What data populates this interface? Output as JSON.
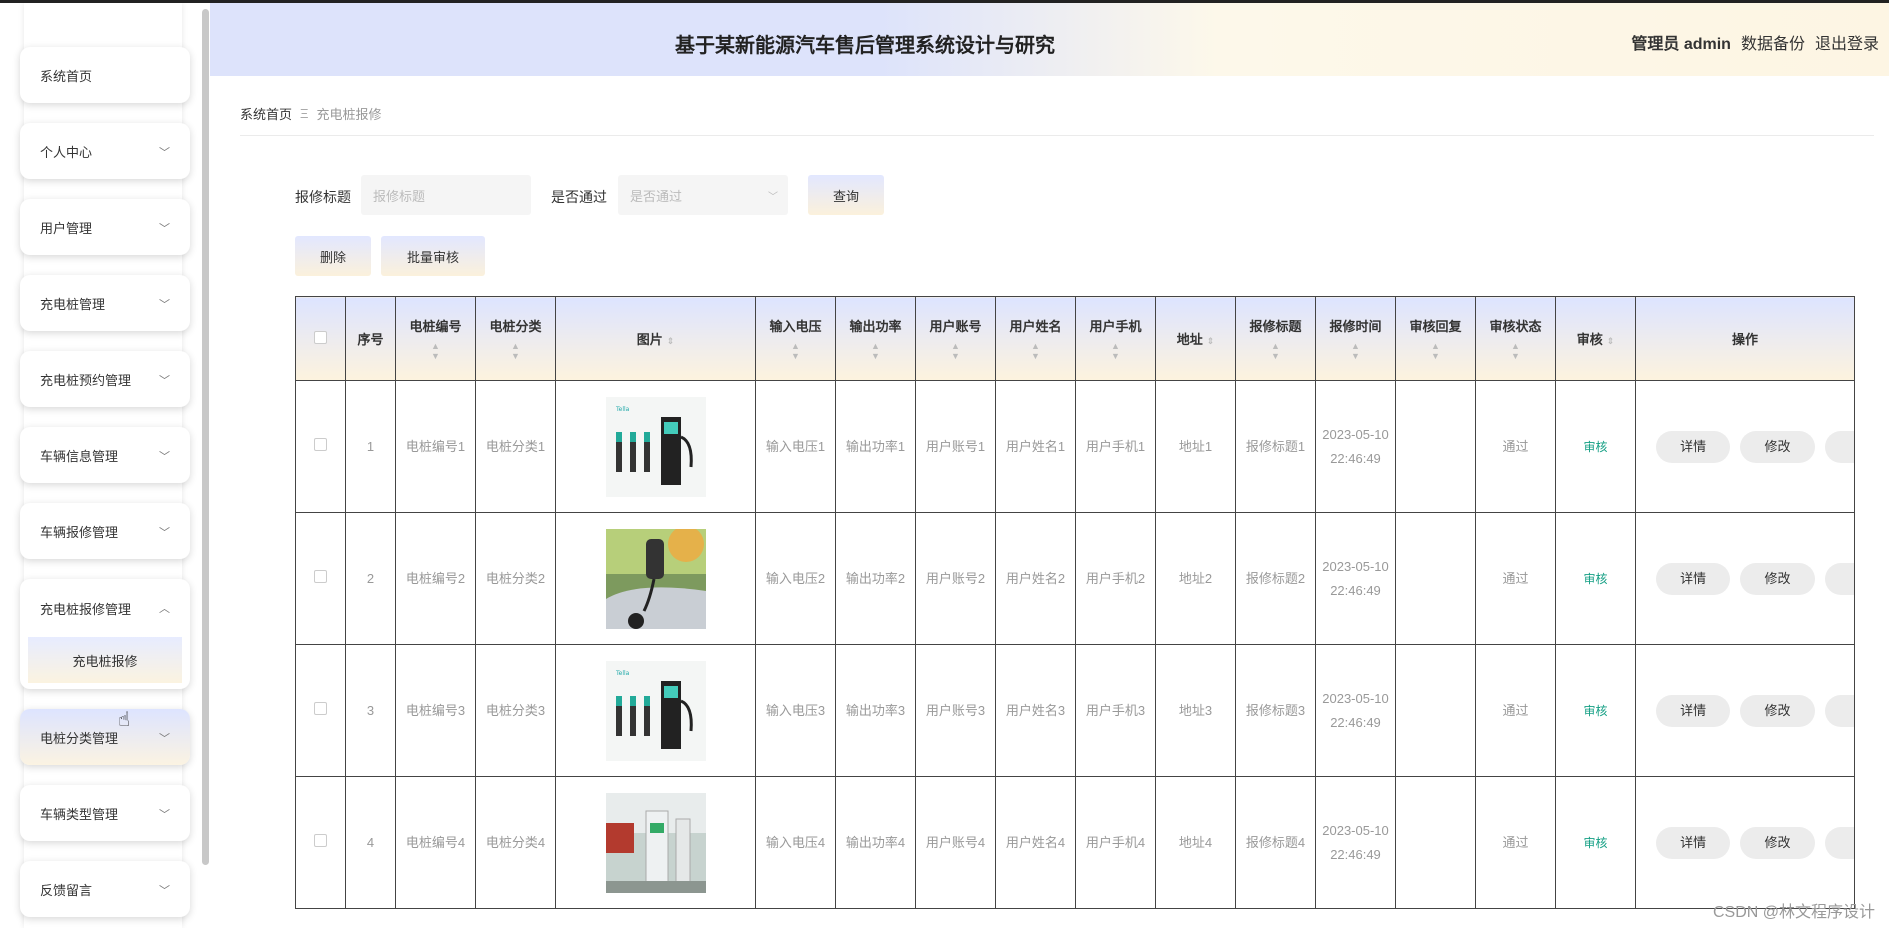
{
  "header": {
    "title": "基于某新能源汽车售后管理系统设计与研究",
    "admin": "管理员 admin",
    "backup": "数据备份",
    "logout": "退出登录"
  },
  "sidebar": {
    "items": [
      {
        "label": "系统首页"
      },
      {
        "label": "个人中心"
      },
      {
        "label": "用户管理"
      },
      {
        "label": "充电桩管理"
      },
      {
        "label": "充电桩预约管理"
      },
      {
        "label": "车辆信息管理"
      },
      {
        "label": "车辆报修管理"
      },
      {
        "label": "充电桩报修管理",
        "sub": "充电桩报修"
      },
      {
        "label": "电桩分类管理"
      },
      {
        "label": "车辆类型管理"
      },
      {
        "label": "反馈留言"
      }
    ]
  },
  "breadcrumb": {
    "home": "系统首页",
    "sep": "Ξ",
    "current": "充电桩报修"
  },
  "search": {
    "title_label": "报修标题",
    "title_placeholder": "报修标题",
    "pass_label": "是否通过",
    "pass_placeholder": "是否通过",
    "query": "查询",
    "delete": "删除",
    "batch": "批量审核"
  },
  "table": {
    "headers": [
      "序号",
      "电桩编号",
      "电桩分类",
      "图片",
      "输入电压",
      "输出功率",
      "用户账号",
      "用户姓名",
      "用户手机",
      "地址",
      "报修标题",
      "报修时间",
      "审核回复",
      "审核状态",
      "审核",
      "操作"
    ],
    "rows": [
      {
        "no": "1",
        "code": "电桩编号1",
        "cat": "电桩分类1",
        "vin": "输入电压1",
        "pow": "输出功率1",
        "acct": "用户账号1",
        "name": "用户姓名1",
        "phone": "用户手机1",
        "addr": "地址1",
        "title": "报修标题1",
        "time": "2023-05-10 22:46:49",
        "reply": "",
        "status": "通过",
        "audit": "审核",
        "img": "charger"
      },
      {
        "no": "2",
        "code": "电桩编号2",
        "cat": "电桩分类2",
        "vin": "输入电压2",
        "pow": "输出功率2",
        "acct": "用户账号2",
        "name": "用户姓名2",
        "phone": "用户手机2",
        "addr": "地址2",
        "title": "报修标题2",
        "time": "2023-05-10 22:46:49",
        "reply": "",
        "status": "通过",
        "audit": "审核",
        "img": "car"
      },
      {
        "no": "3",
        "code": "电桩编号3",
        "cat": "电桩分类3",
        "vin": "输入电压3",
        "pow": "输出功率3",
        "acct": "用户账号3",
        "name": "用户姓名3",
        "phone": "用户手机3",
        "addr": "地址3",
        "title": "报修标题3",
        "time": "2023-05-10 22:46:49",
        "reply": "",
        "status": "通过",
        "audit": "审核",
        "img": "charger"
      },
      {
        "no": "4",
        "code": "电桩编号4",
        "cat": "电桩分类4",
        "vin": "输入电压4",
        "pow": "输出功率4",
        "acct": "用户账号4",
        "name": "用户姓名4",
        "phone": "用户手机4",
        "addr": "地址4",
        "title": "报修标题4",
        "time": "2023-05-10 22:46:49",
        "reply": "",
        "status": "通过",
        "audit": "审核",
        "img": "station"
      }
    ],
    "actions": {
      "detail": "详情",
      "edit": "修改"
    }
  },
  "watermark": "CSDN @林文程序设计",
  "colors": {
    "audit": "#16a085",
    "header_left": "#dde3fb",
    "header_right": "#fdf5e3"
  }
}
